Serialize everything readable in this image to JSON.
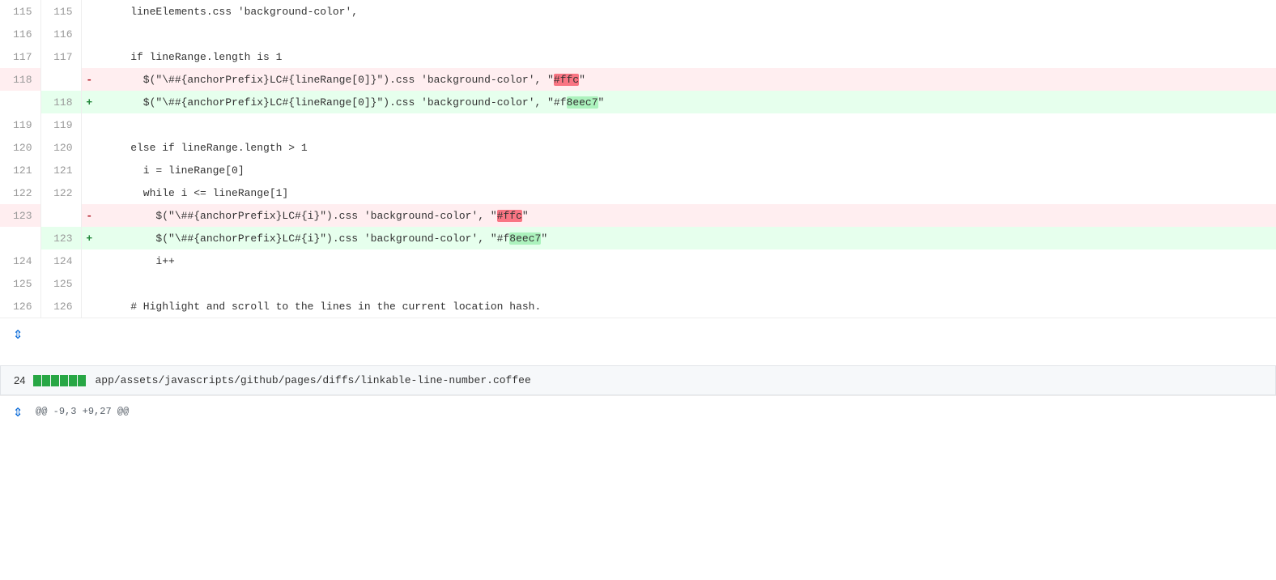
{
  "diff": {
    "lines": [
      {
        "old_num": "115",
        "new_num": "115",
        "type": "normal",
        "code": "    lineElements.css 'background-color',"
      },
      {
        "old_num": "116",
        "new_num": "116",
        "type": "normal",
        "code": ""
      },
      {
        "old_num": "117",
        "new_num": "117",
        "type": "normal",
        "code": "    if lineRange.length is 1"
      },
      {
        "old_num": "118",
        "new_num": "",
        "type": "del",
        "marker": "-",
        "code_parts": [
          {
            "text": "      $(\"\\##",
            "hl": false
          },
          {
            "text": "{anchorPrefix}LC#",
            "hl": false
          },
          {
            "text": "{lineRange[0]}",
            "hl": false
          },
          {
            "text": "\").css 'background-color', \"",
            "hl": false
          },
          {
            "text": "#ffc",
            "hl": "red"
          },
          {
            "text": "\"",
            "hl": false
          }
        ]
      },
      {
        "old_num": "",
        "new_num": "118",
        "type": "add",
        "marker": "+",
        "code_parts": [
          {
            "text": "      $(\"\\##",
            "hl": false
          },
          {
            "text": "{anchorPrefix}LC#",
            "hl": false
          },
          {
            "text": "{lineRange[0]}",
            "hl": false
          },
          {
            "text": "\").css 'background-color', \"#f",
            "hl": false
          },
          {
            "text": "8eec7",
            "hl": "green"
          },
          {
            "text": "\"",
            "hl": false
          }
        ]
      },
      {
        "old_num": "119",
        "new_num": "119",
        "type": "normal",
        "code": ""
      },
      {
        "old_num": "120",
        "new_num": "120",
        "type": "normal",
        "code": "    else if lineRange.length > 1"
      },
      {
        "old_num": "121",
        "new_num": "121",
        "type": "normal",
        "code": "      i = lineRange[0]"
      },
      {
        "old_num": "122",
        "new_num": "122",
        "type": "normal",
        "code": "      while i <= lineRange[1]"
      },
      {
        "old_num": "123",
        "new_num": "",
        "type": "del",
        "marker": "-",
        "code_parts": [
          {
            "text": "        $(\"\\##",
            "hl": false
          },
          {
            "text": "{anchorPrefix}LC#",
            "hl": false
          },
          {
            "text": "{i}",
            "hl": false
          },
          {
            "text": "\").css 'background-color', \"",
            "hl": false
          },
          {
            "text": "#ffc",
            "hl": "red"
          },
          {
            "text": "\"",
            "hl": false
          }
        ]
      },
      {
        "old_num": "",
        "new_num": "123",
        "type": "add",
        "marker": "+",
        "code_parts": [
          {
            "text": "        $(\"\\##",
            "hl": false
          },
          {
            "text": "{anchorPrefix}LC#",
            "hl": false
          },
          {
            "text": "{i}",
            "hl": false
          },
          {
            "text": "\").css 'background-color', \"#f",
            "hl": false
          },
          {
            "text": "8eec7",
            "hl": "green"
          },
          {
            "text": "\"",
            "hl": false
          }
        ]
      },
      {
        "old_num": "124",
        "new_num": "124",
        "type": "normal",
        "code": "        i++"
      },
      {
        "old_num": "125",
        "new_num": "125",
        "type": "normal",
        "code": ""
      },
      {
        "old_num": "126",
        "new_num": "126",
        "type": "normal",
        "code": "    # Highlight and scroll to the lines in the current location hash."
      }
    ],
    "file_section": {
      "number": "24",
      "diff_blocks": 6,
      "path": "app/assets/javascripts/github/pages/diffs/linkable-line-number.coffee"
    },
    "hunk_info": "@@ -9,3 +9,27 @@",
    "expand_icon": "⇕",
    "expand_icon_bottom": "⇕"
  }
}
